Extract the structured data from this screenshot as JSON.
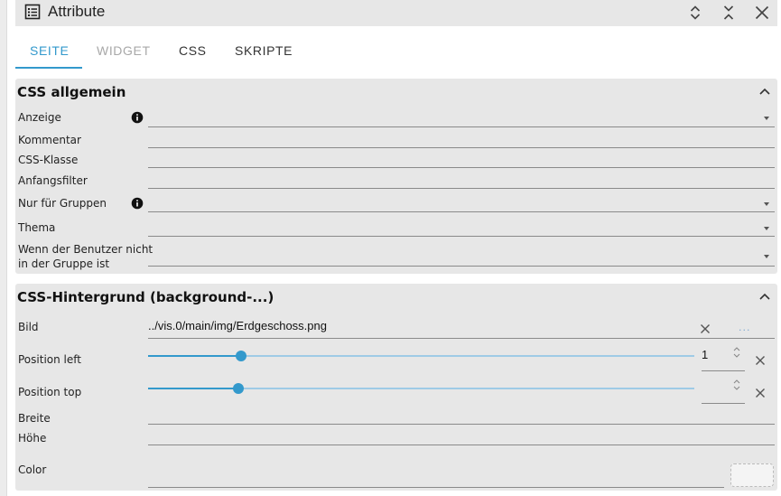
{
  "panel": {
    "title": "Attribute",
    "icon": "list-icon",
    "actions": [
      "expand-all-icon",
      "collapse-all-icon",
      "close-icon"
    ]
  },
  "tabs": [
    {
      "label": "SEITE",
      "state": "active"
    },
    {
      "label": "WIDGET",
      "state": "disabled"
    },
    {
      "label": "CSS",
      "state": "normal"
    },
    {
      "label": "SKRIPTE",
      "state": "normal"
    }
  ],
  "sections": {
    "css_allgemein": {
      "title": "CSS allgemein",
      "fields": [
        {
          "label": "Anzeige",
          "type": "select",
          "value": "",
          "info": true
        },
        {
          "label": "Kommentar",
          "type": "text",
          "value": ""
        },
        {
          "label": "CSS-Klasse",
          "type": "text",
          "value": ""
        },
        {
          "label": "Anfangsfilter",
          "type": "text",
          "value": ""
        },
        {
          "label": "Nur für Gruppen",
          "type": "select",
          "value": "",
          "info": true
        },
        {
          "label": "Thema",
          "type": "select",
          "value": ""
        },
        {
          "label": "Wenn der Benutzer nicht in der Gruppe ist",
          "label_line1": "Wenn der Benutzer nicht",
          "label_line2": "in der Gruppe ist",
          "type": "select",
          "value": ""
        }
      ]
    },
    "css_hintergrund": {
      "title": "CSS-Hintergrund (background-...)",
      "bild": {
        "label": "Bild",
        "value": "../vis.0/main/img/Erdgeschoss.png",
        "browse": "..."
      },
      "position_left": {
        "label": "Position left",
        "value": "1",
        "slider_fraction": 0.17
      },
      "position_top": {
        "label": "Position top",
        "value": "",
        "slider_fraction": 0.165
      },
      "breite": {
        "label": "Breite",
        "value": ""
      },
      "hoehe": {
        "label": "Höhe",
        "value": ""
      },
      "color": {
        "label": "Color",
        "value": ""
      }
    }
  },
  "colors": {
    "accent": "#3399cc",
    "section_bg": "#e7e7e7",
    "disabled_tab": "#a8a8a8"
  }
}
